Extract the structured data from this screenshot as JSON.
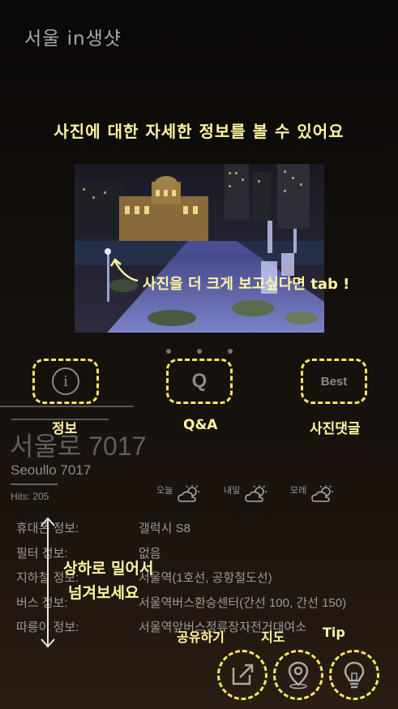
{
  "app": {
    "title": "서울 in생샷"
  },
  "hints": {
    "top": "사진에 대한 자세한 정보를 볼 수 있어요",
    "tap": "사진을 더 크게 보고싶다면 tab !",
    "scroll_line1": "상하로 밀어서",
    "scroll_line2": "넘겨보세요"
  },
  "photo": {
    "pager_dots": 3
  },
  "tabs": [
    {
      "id": "info",
      "icon": "info-icon",
      "glyph": "i",
      "label": "정보"
    },
    {
      "id": "qa",
      "icon": "qa-icon",
      "glyph": "Q",
      "label": "Q&A"
    },
    {
      "id": "best",
      "icon": "best-icon",
      "glyph": "Best",
      "label": "사진댓글"
    }
  ],
  "place": {
    "name": "서울로 7017",
    "subtitle": "Seoullo 7017",
    "hits": "Hits: 205"
  },
  "weather": [
    {
      "day": "오늘",
      "icon": "partly-cloudy-icon"
    },
    {
      "day": "내일",
      "icon": "partly-cloudy-icon"
    },
    {
      "day": "모레",
      "icon": "partly-cloudy-icon"
    }
  ],
  "info_rows": [
    {
      "key": "휴대폰 정보:",
      "value": "갤럭시  S8"
    },
    {
      "key": "필터 정보:",
      "value": "없음"
    },
    {
      "key": "지하철 정보:",
      "value": "서울역(1호선, 공항철도선)"
    },
    {
      "key": "버스 정보:",
      "value": "서울역버스환승센터(간선 100, 간선 150)"
    },
    {
      "key": "따릉이 정보:",
      "value": "서울역앞버스정류장자전거대여소"
    }
  ],
  "actions": [
    {
      "id": "share",
      "icon": "share-icon",
      "label": "공유하기"
    },
    {
      "id": "map",
      "icon": "map-pin-icon",
      "label": "지도"
    },
    {
      "id": "tip",
      "icon": "lightbulb-icon",
      "label": "Tip"
    }
  ],
  "colors": {
    "highlight": "#f5e663",
    "hint_text": "#fff6a0",
    "muted_text": "#9a9a9a"
  }
}
